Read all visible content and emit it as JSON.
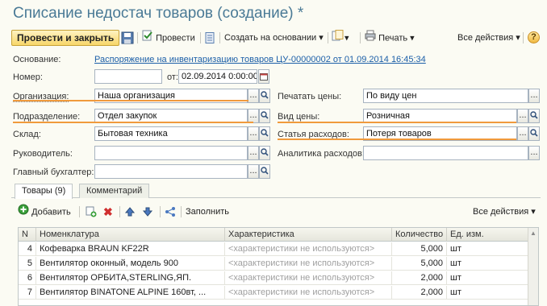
{
  "title": "Списание недостач товаров (создание) *",
  "toolbar": {
    "post_close": "Провести и закрыть",
    "post": "Провести",
    "create_based": "Создать на основании",
    "print": "Печать",
    "all_actions": "Все действия",
    "help": "?"
  },
  "form": {
    "basis_label": "Основание:",
    "basis_value": "Распоряжение на инвентаризацию товаров ЦУ-00000002 от 01.09.2014 16:45:34",
    "number_label": "Номер:",
    "number_value": "",
    "from_label": "от:",
    "date_value": "02.09.2014  0:00:00",
    "org_label": "Организация:",
    "org_value": "Наша организация",
    "dept_label": "Подразделение:",
    "dept_value": "Отдел закупок",
    "warehouse_label": "Склад:",
    "warehouse_value": "Бытовая техника",
    "manager_label": "Руководитель:",
    "manager_value": "",
    "accountant_label": "Главный бухгалтер:",
    "accountant_value": "",
    "print_prices_label": "Печатать цены:",
    "print_prices_value": "По виду цен",
    "price_type_label": "Вид цены:",
    "price_type_value": "Розничная",
    "expense_label": "Статья расходов:",
    "expense_value": "Потеря товаров",
    "analytics_label": "Аналитика расходов:",
    "analytics_value": ""
  },
  "tabs": [
    "Товары (9)",
    "Комментарий"
  ],
  "subtoolbar": {
    "add": "Добавить",
    "fill": "Заполнить",
    "all_actions": "Все действия"
  },
  "table": {
    "headers": [
      "N",
      "Номенклатура",
      "Характеристика",
      "Количество",
      "Ед. изм."
    ],
    "rows": [
      {
        "n": "4",
        "item": "Кофеварка BRAUN KF22R",
        "char": "<характеристики не используются>",
        "qty": "5,000",
        "unit": "шт"
      },
      {
        "n": "5",
        "item": "Вентилятор оконный, модель 900",
        "char": "<характеристики не используются>",
        "qty": "5,000",
        "unit": "шт"
      },
      {
        "n": "6",
        "item": "Вентилятор ОРБИТА,STERLING,ЯП.",
        "char": "<характеристики не используются>",
        "qty": "2,000",
        "unit": "шт"
      },
      {
        "n": "7",
        "item": "Вентилятор BINATONE ALPINE 160вт, ...",
        "char": "<характеристики не используются>",
        "qty": "2,000",
        "unit": "шт"
      }
    ]
  },
  "colors": {
    "title": "#4a7a96",
    "accent": "#f09a3c",
    "link": "#1c5fa8"
  }
}
